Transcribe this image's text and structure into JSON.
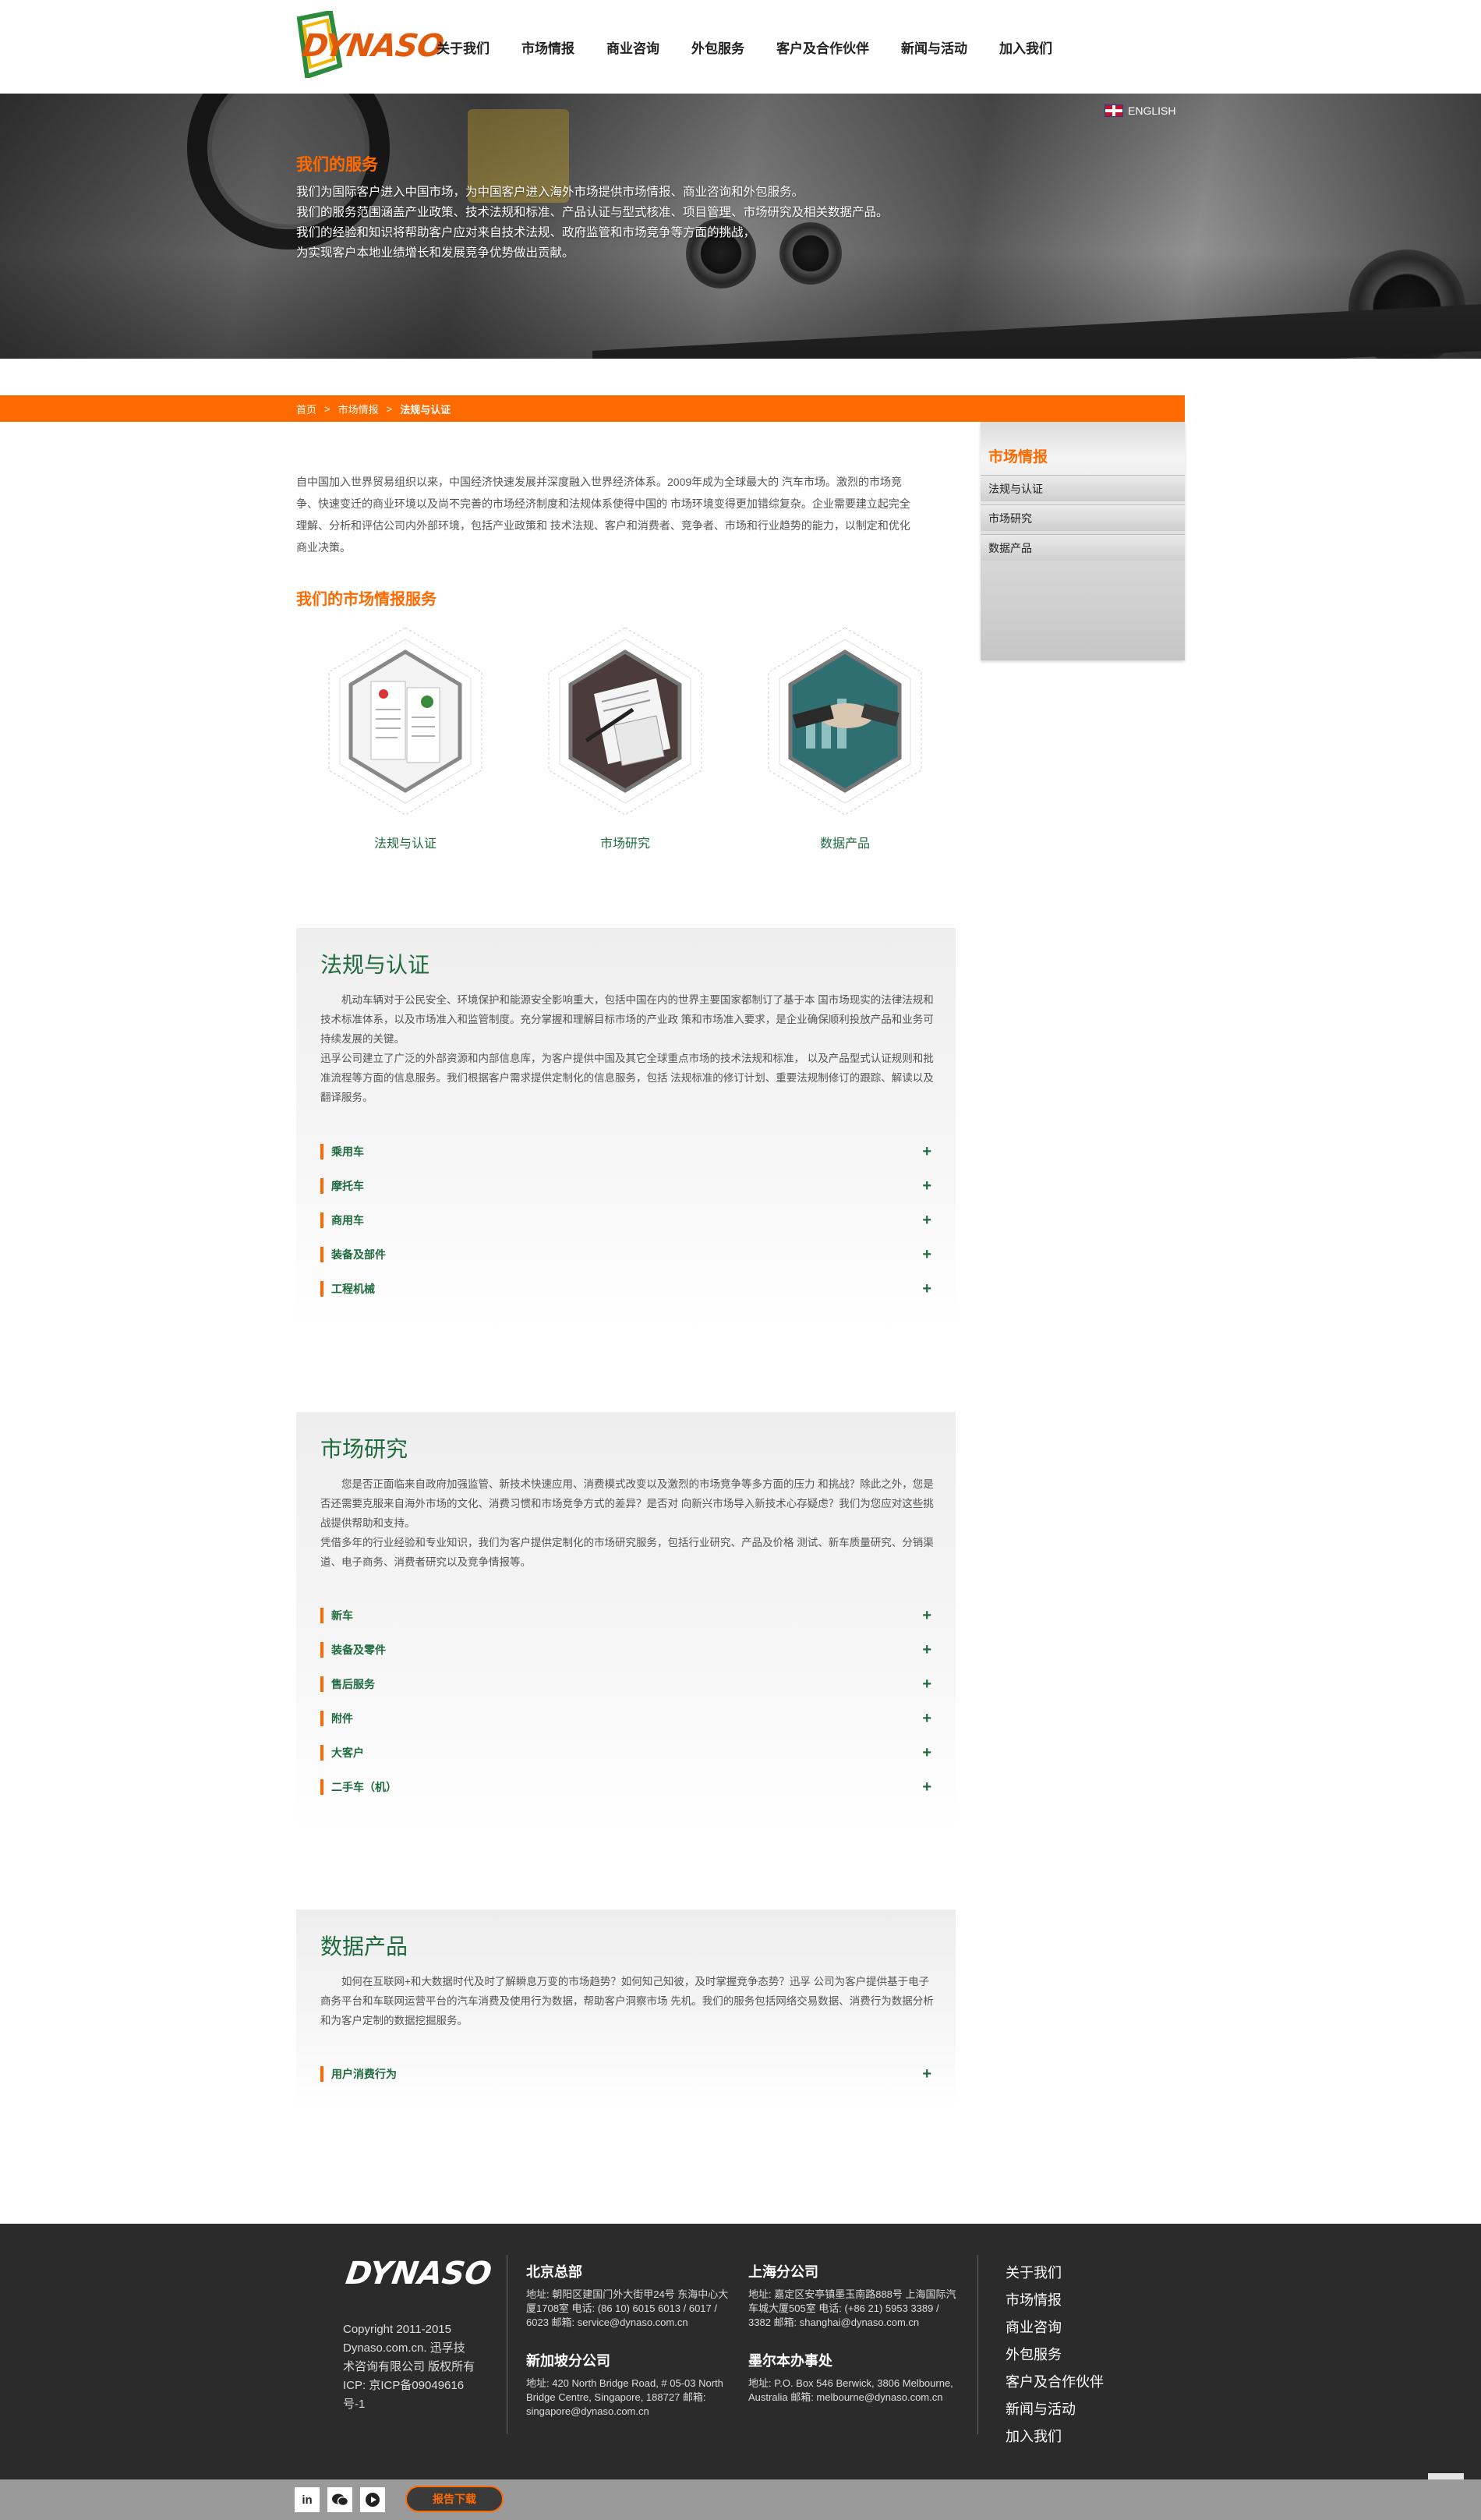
{
  "brand": {
    "logo_text": "DYNASO"
  },
  "nav": {
    "items": [
      "关于我们",
      "市场情报",
      "商业咨询",
      "外包服务",
      "客户及合作伙伴",
      "新闻与活动",
      "加入我们"
    ]
  },
  "lang": {
    "label": "ENGLISH"
  },
  "banner": {
    "title": "我们的服务",
    "lines": [
      "我们为国际客户进入中国市场，为中国客户进入海外市场提供市场情报、商业咨询和外包服务。",
      "我们的服务范围涵盖产业政策、技术法规和标准、产品认证与型式核准、项目管理、市场研究及相关数据产品。",
      "我们的经验和知识将帮助客户应对来自技术法规、政府监管和市场竞争等方面的挑战，",
      "为实现客户本地业绩增长和发展竞争优势做出贡献。"
    ]
  },
  "breadcrumb": {
    "home": "首页",
    "sep": ">",
    "section": "市场情报",
    "current": "法规与认证"
  },
  "sidebar": {
    "title": "市场情报",
    "items": [
      "法规与认证",
      "市场研究",
      "数据产品"
    ]
  },
  "intro": "自中国加入世界贸易组织以来，中国经济快速发展并深度融入世界经济体系。2009年成为全球最大的 汽车市场。激烈的市场竞争、快速变迁的商业环境以及尚不完善的市场经济制度和法规体系使得中国的 市场环境变得更加错综复杂。企业需要建立起完全理解、分析和评估公司内外部环境，包括产业政策和 技术法规、客户和消费者、竞争者、市场和行业趋势的能力，以制定和优化商业决策。",
  "services": {
    "title": "我们的市场情报服务",
    "items": [
      {
        "label": "法规与认证",
        "icon": "certificate-image"
      },
      {
        "label": "市场研究",
        "icon": "document-review-image"
      },
      {
        "label": "数据产品",
        "icon": "handshake-image"
      }
    ]
  },
  "sections": [
    {
      "title": "法规与认证",
      "paragraphs": [
        "　　机动车辆对于公民安全、环境保护和能源安全影响重大，包括中国在内的世界主要国家都制订了基于本 国市场现实的法律法规和技术标准体系，以及市场准入和监管制度。充分掌握和理解目标市场的产业政 策和市场准入要求，是企业确保顺利投放产品和业务可持续发展的关键。",
        "迅孚公司建立了广泛的外部资源和内部信息库，为客户提供中国及其它全球重点市场的技术法规和标准， 以及产品型式认证规则和批准流程等方面的信息服务。我们根据客户需求提供定制化的信息服务，包括 法规标准的修订计划、重要法规制修订的跟踪、解读以及翻译服务。"
      ],
      "accordion": [
        "乘用车",
        "摩托车",
        "商用车",
        "装备及部件",
        "工程机械"
      ]
    },
    {
      "title": "市场研究",
      "paragraphs": [
        "　　您是否正面临来自政府加强监管、新技术快速应用、消费模式改变以及激烈的市场竞争等多方面的压力 和挑战？除此之外，您是否还需要克服来自海外市场的文化、消费习惯和市场竞争方式的差异？是否对 向新兴市场导入新技术心存疑虑？我们为您应对这些挑战提供帮助和支持。",
        "凭借多年的行业经验和专业知识，我们为客户提供定制化的市场研究服务，包括行业研究、产品及价格 测试、新车质量研究、分销渠道、电子商务、消费者研究以及竞争情报等。"
      ],
      "accordion": [
        "新车",
        "装备及零件",
        "售后服务",
        "附件",
        "大客户",
        "二手车（机）"
      ]
    },
    {
      "title": "数据产品",
      "paragraphs": [
        "　　如何在互联网+和大数据时代及时了解瞬息万变的市场趋势？如何知己知彼，及时掌握竞争态势？迅孚 公司为客户提供基于电子商务平台和车联网运营平台的汽车消费及使用行为数据，帮助客户洞察市场 先机。我们的服务包括网络交易数据、消费行为数据分析和为客户定制的数据挖掘服务。"
      ],
      "accordion": [
        "用户消费行为"
      ]
    }
  ],
  "footer": {
    "logo_text": "DYNASO",
    "copyright": "Copyright 2011-2015 Dynaso.com.cn. 迅孚技术咨询有限公司 版权所有 ICP: 京ICP备09049616号-1",
    "offices": [
      {
        "name": "北京总部",
        "text": "地址: 朝阳区建国门外大街甲24号 东海中心大厦1708室 电话: (86 10) 6015 6013 / 6017 / 6023 邮箱: service@dynaso.com.cn"
      },
      {
        "name": "上海分公司",
        "text": "地址: 嘉定区安亭镇墨玉南路888号 上海国际汽车城大厦505室 电话: (+86 21) 5953 3389 / 3382 邮箱: shanghai@dynaso.com.cn"
      },
      {
        "name": "新加坡分公司",
        "text": "地址: 420 North Bridge Road, # 05-03 North Bridge Centre, Singapore, 188727 邮箱: singapore@dynaso.com.cn"
      },
      {
        "name": "墨尔本办事处",
        "text": "地址: P.O. Box 546 Berwick, 3806 Melbourne, Australia 邮箱: melbourne@dynaso.com.cn"
      }
    ],
    "links": [
      "关于我们",
      "市场情报",
      "商业咨询",
      "外包服务",
      "客户及合作伙伴",
      "新闻与活动",
      "加入我们"
    ]
  },
  "bottombar": {
    "social": [
      "linkedin-icon",
      "wechat-icon",
      "play-icon"
    ],
    "download_label": "报告下载"
  },
  "colors": {
    "accent": "#ff6a00",
    "green": "#1f6b3e",
    "footer": "#2b2b2b"
  }
}
